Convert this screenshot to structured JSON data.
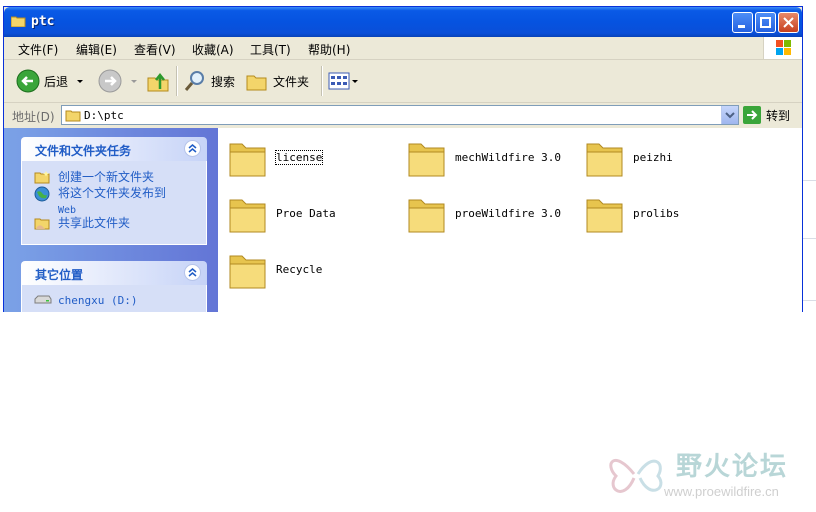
{
  "window": {
    "title": "ptc"
  },
  "menu": [
    "文件(F)",
    "编辑(E)",
    "查看(V)",
    "收藏(A)",
    "工具(T)",
    "帮助(H)"
  ],
  "toolbar": {
    "back_label": "后退",
    "search_label": "搜索",
    "folders_label": "文件夹"
  },
  "address": {
    "label": "地址(D)",
    "value": "D:\\ptc",
    "go_label": "转到"
  },
  "tasks_panel": {
    "title": "文件和文件夹任务",
    "items": [
      {
        "label": "创建一个新文件夹",
        "icon": "new-folder-icon"
      },
      {
        "label": "将这个文件夹发布到",
        "label2": "Web",
        "icon": "publish-web-icon"
      },
      {
        "label": "共享此文件夹",
        "icon": "share-folder-icon"
      }
    ]
  },
  "places_panel": {
    "title": "其它位置",
    "items": [
      {
        "label": "chengxu (D:)",
        "icon": "drive-icon"
      }
    ]
  },
  "files": [
    {
      "name": "license"
    },
    {
      "name": "mechWildfire 3.0"
    },
    {
      "name": "peizhi"
    },
    {
      "name": "Proe Data"
    },
    {
      "name": "proeWildfire 3.0"
    },
    {
      "name": "prolibs"
    },
    {
      "name": "Recycle"
    }
  ],
  "watermark": {
    "text": "野火论坛",
    "url": "www.proewildfire.cn"
  },
  "colors": {
    "titlebar": "#0653e0",
    "taskpane": "#6375d6",
    "link": "#215dc6"
  }
}
